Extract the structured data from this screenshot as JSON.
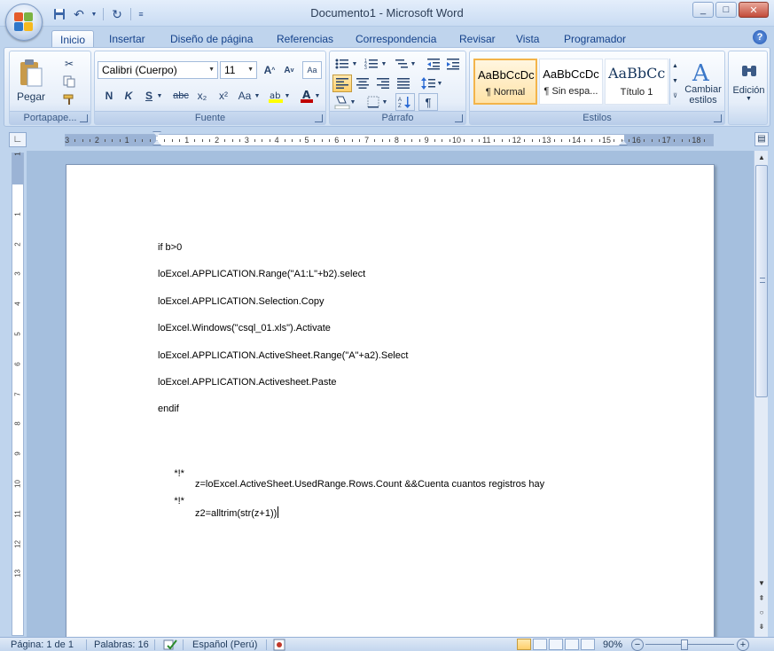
{
  "window": {
    "title": "Documento1 - Microsoft Word",
    "controls": {
      "minimize": "_",
      "maximize": "□",
      "close": "✕"
    }
  },
  "qat": {
    "icons": [
      "save-icon",
      "undo-icon",
      "redo-icon",
      "customize-icon"
    ]
  },
  "tabs": [
    {
      "label": "Inicio",
      "active": true
    },
    {
      "label": "Insertar"
    },
    {
      "label": "Diseño de página"
    },
    {
      "label": "Referencias"
    },
    {
      "label": "Correspondencia"
    },
    {
      "label": "Revisar"
    },
    {
      "label": "Vista"
    },
    {
      "label": "Programador"
    }
  ],
  "ribbon": {
    "clipboard": {
      "label": "Portapape...",
      "paste": "Pegar"
    },
    "font": {
      "label": "Fuente",
      "name": "Calibri (Cuerpo)",
      "size": "11",
      "bold": "N",
      "italic": "K",
      "underline": "S",
      "strike": "abc",
      "subscript": "x₂",
      "superscript": "x²",
      "case": "Aa"
    },
    "paragraph": {
      "label": "Párrafo"
    },
    "styles": {
      "label": "Estilos",
      "items": [
        {
          "sample": "AaBbCcDc",
          "name": "¶ Normal",
          "selected": true
        },
        {
          "sample": "AaBbCcDc",
          "name": "¶ Sin espa..."
        },
        {
          "sample": "AaBbCc",
          "name": "Título 1"
        }
      ],
      "change": "Cambiar estilos"
    },
    "editing": {
      "label": "Edición"
    }
  },
  "ruler": {
    "numbers": [
      "3",
      "2",
      "1",
      "1",
      "2",
      "3",
      "4",
      "5",
      "6",
      "7",
      "8",
      "9",
      "10",
      "11",
      "12",
      "13",
      "14",
      "15",
      "16",
      "17",
      "18"
    ],
    "vertical_numbers": [
      "2",
      "1",
      "1",
      "2",
      "3",
      "4",
      "5",
      "6",
      "7",
      "8",
      "9",
      "10",
      "11",
      "12",
      "13"
    ]
  },
  "document": {
    "lines": [
      {
        "text": "if b>0"
      },
      {
        "text": "loExcel.APPLICATION.Range(\"A1:L\"+b2).select"
      },
      {
        "text": "loExcel.APPLICATION.Selection.Copy"
      },
      {
        "text": "loExcel.Windows(\"csql_01.xls\").Activate"
      },
      {
        "text": "loExcel.APPLICATION.ActiveSheet.Range(\"A\"+a2).Select"
      },
      {
        "text": "loExcel.APPLICATION.Activesheet.Paste"
      },
      {
        "text": "endif"
      },
      {
        "text": ""
      },
      {
        "prefix": "*!*",
        "text": "z=loExcel.ActiveSheet.UsedRange.Rows.Count &&Cuenta cuantos registros hay"
      },
      {
        "prefix": "*!*",
        "text": "z2=alltrim(str(z+1))"
      }
    ]
  },
  "statusbar": {
    "page": "Página: 1 de 1",
    "words": "Palabras: 16",
    "language": "Español (Perú)",
    "zoom": "90%"
  },
  "colors": {
    "ribbon_bg": "#dfe9f6",
    "accent": "#15428b",
    "selected_style": "#ffe3a8"
  }
}
